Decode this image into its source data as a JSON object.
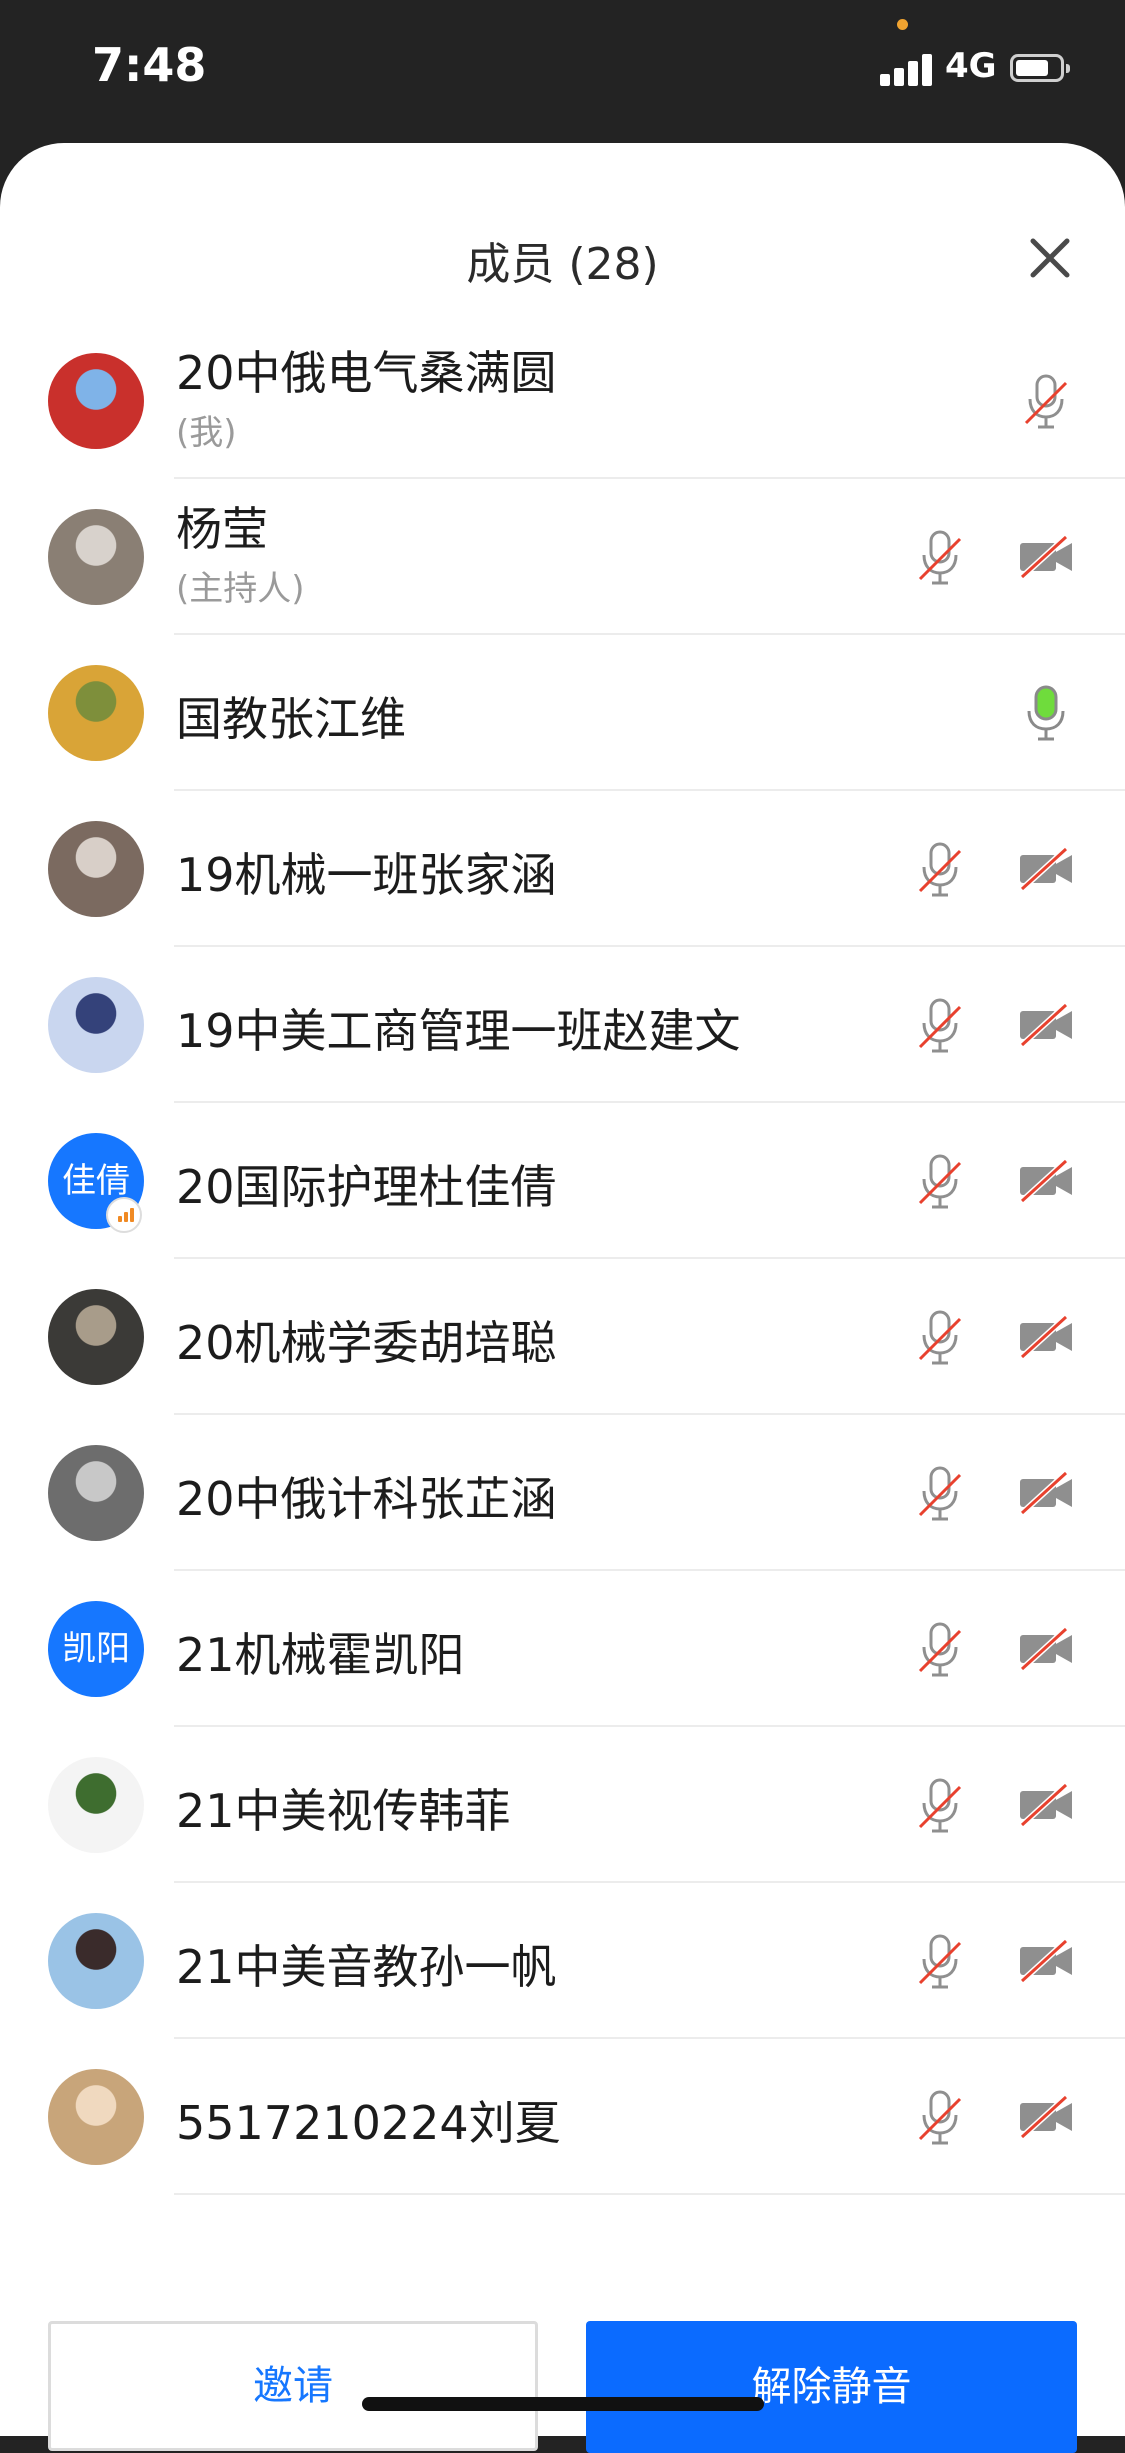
{
  "status_bar": {
    "time": "7:48",
    "network": "4G",
    "battery_level": 0.75
  },
  "header": {
    "title": "成员 (28)",
    "close_icon": "close-icon"
  },
  "members": [
    {
      "name": "20中俄电气桑满圆",
      "role": "(我)",
      "mic": "muted",
      "camera": null
    },
    {
      "name": "杨莹",
      "role": "(主持人)",
      "mic": "muted",
      "camera": "off"
    },
    {
      "name": "国教张江维",
      "role": "",
      "mic": "active",
      "camera": null
    },
    {
      "name": "19机械一班张家涵",
      "role": "",
      "mic": "muted",
      "camera": "off"
    },
    {
      "name": "19中美工商管理一班赵建文",
      "role": "",
      "mic": "muted",
      "camera": "off"
    },
    {
      "name": "20国际护理杜佳倩",
      "role": "",
      "mic": "muted",
      "camera": "off",
      "avatar_text": "佳倩"
    },
    {
      "name": "20机械学委胡培聪",
      "role": "",
      "mic": "muted",
      "camera": "off"
    },
    {
      "name": "20中俄计科张芷涵",
      "role": "",
      "mic": "muted",
      "camera": "off"
    },
    {
      "name": "21机械霍凯阳",
      "role": "",
      "mic": "muted",
      "camera": "off",
      "avatar_text": "凯阳"
    },
    {
      "name": "21中美视传韩菲",
      "role": "",
      "mic": "muted",
      "camera": "off"
    },
    {
      "name": "21中美音教孙一帆",
      "role": "",
      "mic": "muted",
      "camera": "off"
    },
    {
      "name": "5517210224刘夏",
      "role": "",
      "mic": "muted",
      "camera": "off"
    }
  ],
  "buttons": {
    "invite": "邀请",
    "unmute_all": "解除静音"
  },
  "colors": {
    "accent": "#1677ff",
    "mic_active": "#6fdc3c",
    "mute_slash": "#e8412e"
  }
}
